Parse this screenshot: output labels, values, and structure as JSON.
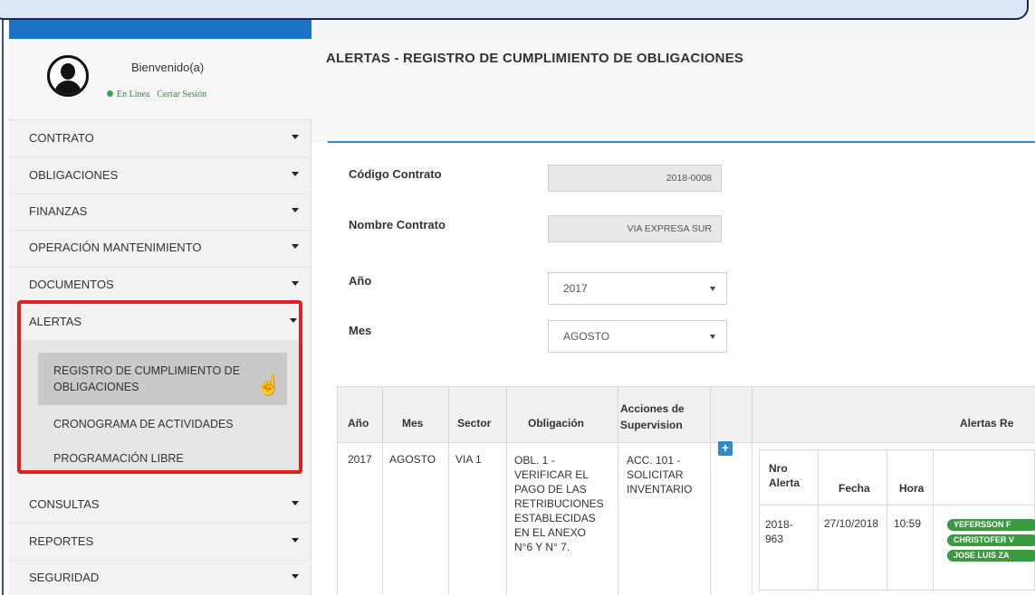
{
  "user": {
    "welcome": "Bienvenido(a)",
    "status": "En Línea",
    "logout": "Cerrar Sesión"
  },
  "sidebar": {
    "items": [
      {
        "label": "CONTRATO"
      },
      {
        "label": "OBLIGACIONES"
      },
      {
        "label": "FINANZAS"
      },
      {
        "label": "OPERACIÓN MANTENIMIENTO"
      },
      {
        "label": "DOCUMENTOS"
      },
      {
        "label": "ALERTAS"
      },
      {
        "label": "CONSULTAS"
      },
      {
        "label": "REPORTES"
      },
      {
        "label": "SEGURIDAD"
      }
    ],
    "alerts_submenu": [
      {
        "label_line1": "REGISTRO DE CUMPLIMIENTO DE",
        "label_line2": "OBLIGACIONES",
        "active": true
      },
      {
        "label_line1": "CRONOGRAMA DE ACTIVIDADES",
        "label_line2": "",
        "active": false
      },
      {
        "label_line1": "PROGRAMACIÓN LIBRE",
        "label_line2": "",
        "active": false
      }
    ]
  },
  "page": {
    "title": "ALERTAS - REGISTRO DE CUMPLIMIENTO DE OBLIGACIONES"
  },
  "form": {
    "codigo_label": "Código Contrato",
    "codigo_value": "2018-0008",
    "nombre_label": "Nombre Contrato",
    "nombre_value": "VIA EXPRESA SUR",
    "anio_label": "Año",
    "anio_value": "2017",
    "mes_label": "Mes",
    "mes_value": "AGOSTO"
  },
  "table": {
    "headers": {
      "anio": "Año",
      "mes": "Mes",
      "sector": "Sector",
      "obligacion": "Obligación",
      "acciones_line1": "Acciones de",
      "acciones_line2": "Supervision",
      "alertas": "Alertas Re"
    },
    "row": {
      "anio": "2017",
      "mes": "AGOSTO",
      "sector": "VIA 1",
      "obligacion_lines": [
        "OBL. 1 -",
        "VERIFICAR EL",
        "PAGO DE LAS",
        "RETRIBUCIONES",
        "ESTABLECIDAS",
        "EN EL ANEXO",
        "N°6 Y N° 7."
      ],
      "acciones_lines": [
        "ACC. 101 -",
        "SOLICITAR",
        "INVENTARIO"
      ],
      "plus": "+"
    },
    "alert_sub": {
      "headers": {
        "nro_line1": "Nro",
        "nro_line2": "Alerta",
        "fecha": "Fecha",
        "hora": "Hora"
      },
      "row": {
        "nro_line1": "2018-",
        "nro_line2": "963",
        "fecha": "27/10/2018",
        "hora": "10:59",
        "people": [
          "YEFERSSON F",
          "CHRISTOFER V",
          "JOSE LUIS ZA"
        ]
      }
    }
  },
  "colors": {
    "accent_blue": "#1a73c7",
    "highlight_red": "#e01f1f",
    "badge_green": "#3a9a3f"
  }
}
